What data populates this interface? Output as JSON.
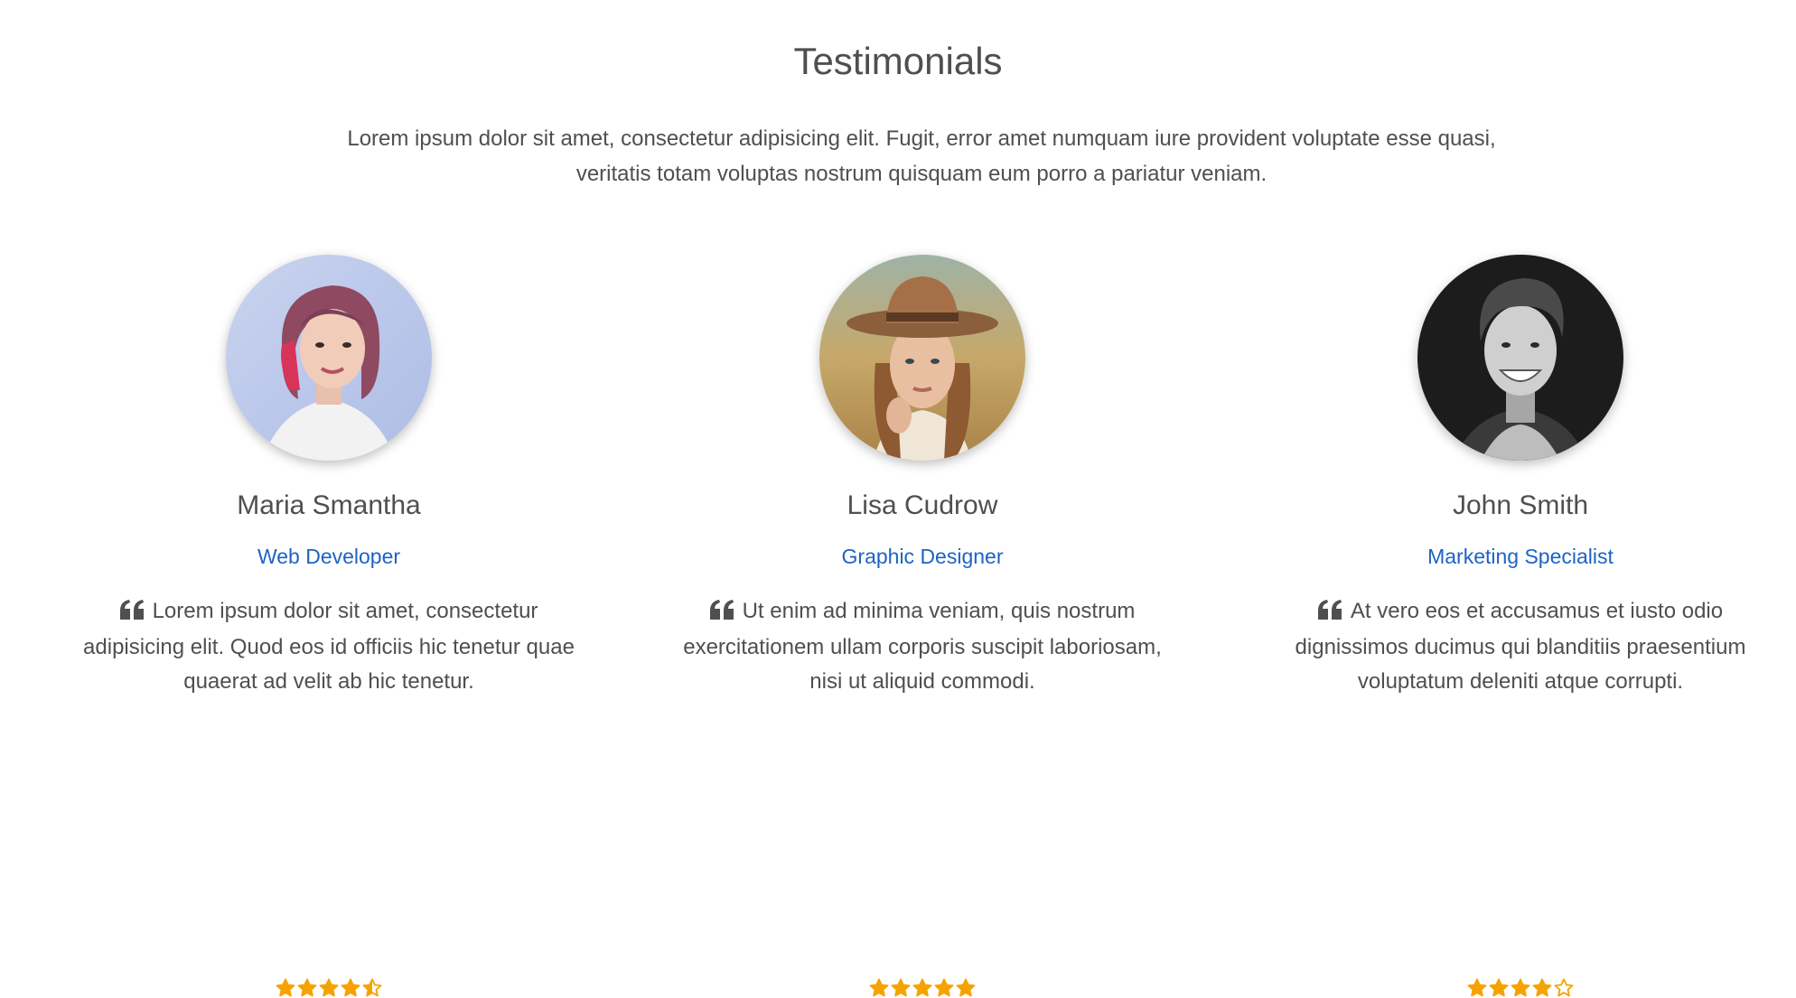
{
  "section": {
    "title": "Testimonials",
    "intro": "Lorem ipsum dolor sit amet, consectetur adipisicing elit. Fugit, error amet numquam iure provident voluptate esse quasi, veritatis totam voluptas nostrum quisquam eum porro a pariatur veniam."
  },
  "colors": {
    "text": "#4f4f4f",
    "role": "#1e63c4",
    "star": "#f5a300"
  },
  "testimonials": [
    {
      "name": "Maria Smantha",
      "role": "Web Developer",
      "quote": "Lorem ipsum dolor sit amet, consectetur adipisicing elit. Quod eos id officiis hic tenetur quae quaerat ad velit ab hic tenetur.",
      "rating": 4.5,
      "avatar_icon": "woman-portrait"
    },
    {
      "name": "Lisa Cudrow",
      "role": "Graphic Designer",
      "quote": "Ut enim ad minima veniam, quis nostrum exercitationem ullam corporis suscipit laboriosam, nisi ut aliquid commodi.",
      "rating": 5,
      "avatar_icon": "woman-hat-portrait"
    },
    {
      "name": "John Smith",
      "role": "Marketing Specialist",
      "quote": "At vero eos et accusamus et iusto odio dignissimos ducimus qui blanditiis praesentium voluptatum deleniti atque corrupti.",
      "rating": 4,
      "avatar_icon": "man-portrait"
    }
  ]
}
